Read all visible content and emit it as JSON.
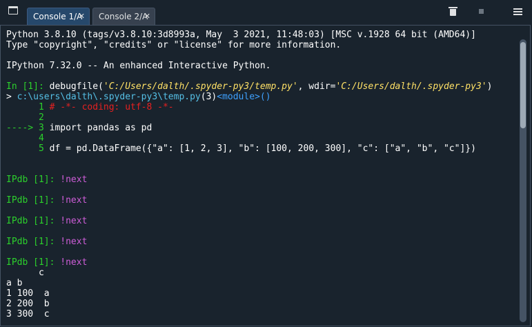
{
  "tabs": [
    {
      "label": "Console 1/A",
      "close": "✕",
      "active": true
    },
    {
      "label": "Console 2/A",
      "close": "✕",
      "active": false
    }
  ],
  "toolbar_icons": [
    "pane-menu-icon",
    "trash-icon",
    "stop-icon",
    "options-menu-icon"
  ],
  "console": {
    "banner1": "Python 3.8.10 (tags/v3.8.10:3d8993a, May  3 2021, 11:48:03) [MSC v.1928 64 bit (AMD64)]",
    "banner2": "Type \"copyright\", \"credits\" or \"license\" for more information.",
    "banner3": "IPython 7.32.0 -- An enhanced Interactive Python.",
    "in_prompt": "In [1]:",
    "in_cmd_head": " debugfile(",
    "in_path1": "'C:/Users/dalth/.spyder-py3/temp.py'",
    "in_sep": ", wdir=",
    "in_path2": "'C:/Users/dalth/.spyder-py3'",
    "in_close": ")",
    "loc_arrow": "> ",
    "loc_path": "c:\\users\\dalth\\.spyder-py3\\temp.py",
    "loc_lineno": "(3)",
    "loc_module": "<module>()",
    "src": [
      {
        "gutter": "      1 ",
        "code": "# -*- coding: utf-8 -*-"
      },
      {
        "gutter": "      2",
        "code": ""
      },
      {
        "gutter": "----> 3 ",
        "code": "import pandas as pd"
      },
      {
        "gutter": "      4",
        "code": ""
      },
      {
        "gutter": "      5 ",
        "code": "df = pd.DataFrame({\"a\": [1, 2, 3], \"b\": [100, 200, 300], \"c\": [\"a\", \"b\", \"c\"]})"
      }
    ],
    "ipdb_prompt": "IPdb [1]:",
    "ipdb_cmd": " !next",
    "df_output": [
      "      c",
      "a b     ",
      "1 100  a",
      "2 200  b",
      "3 300  c"
    ]
  },
  "scrollbar": {
    "position_fraction": 0.0
  }
}
